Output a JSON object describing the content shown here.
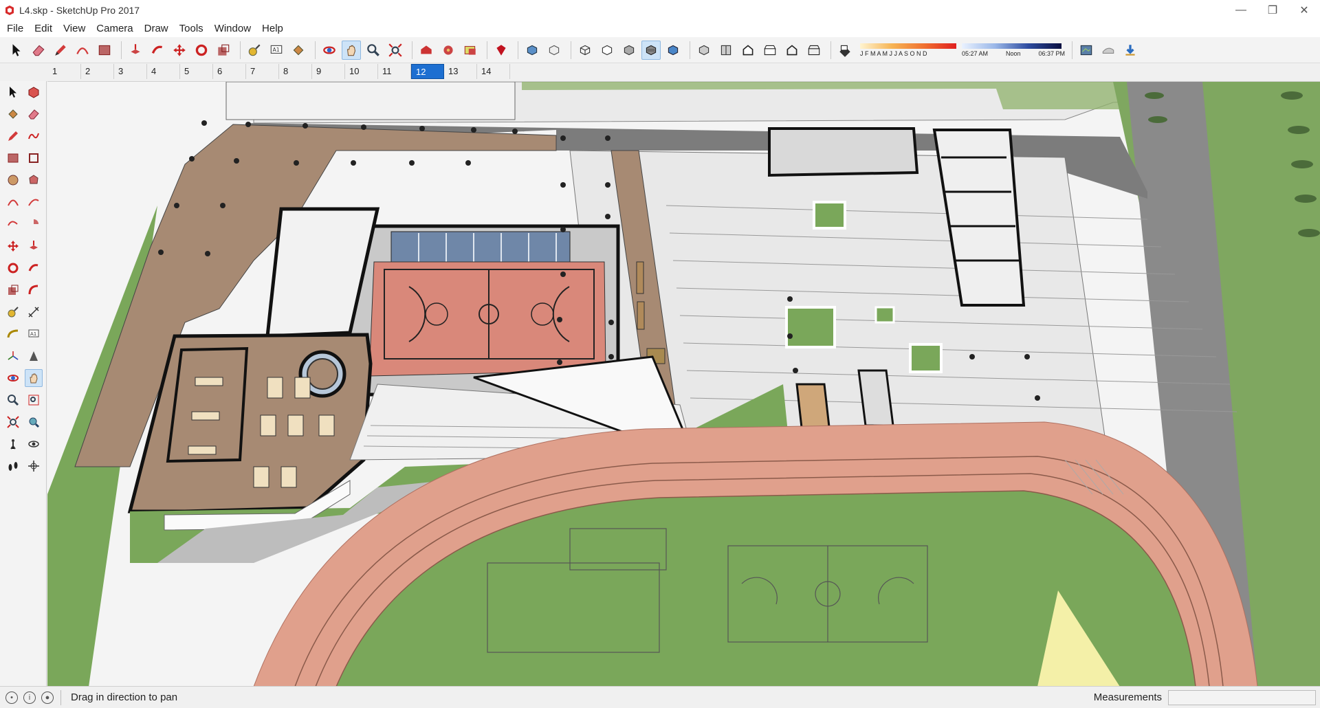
{
  "window": {
    "title": "L4.skp - SketchUp Pro 2017",
    "controls": {
      "minimize": "—",
      "restore": "❐",
      "close": "✕"
    }
  },
  "menu": [
    "File",
    "Edit",
    "View",
    "Camera",
    "Draw",
    "Tools",
    "Window",
    "Help"
  ],
  "toolbar": {
    "shadow_months": "J F M A M J J A S O N D",
    "shadow_times": {
      "start": "05:27 AM",
      "mid": "Noon",
      "end": "06:37 PM"
    },
    "groups": [
      [
        "select-icon",
        "eraser-icon",
        "pencil-icon",
        "arc-icon",
        "rectangle-icon"
      ],
      [
        "push-pull-icon",
        "follow-me-icon",
        "move-icon",
        "rotate-icon",
        "scale-icon"
      ],
      [
        "tape-measure-icon",
        "text-icon",
        "paint-bucket-icon"
      ],
      [
        "orbit-icon",
        "pan-icon",
        "zoom-icon",
        "zoom-extents-icon"
      ],
      [
        "warehouse-icon",
        "extension-warehouse-icon",
        "layout-icon"
      ],
      [
        "ruby-icon"
      ],
      [
        "xray-icon",
        "back-edges-icon"
      ],
      [
        "wireframe-icon",
        "hidden-line-icon",
        "shaded-icon",
        "shaded-textures-icon",
        "monochrome-icon"
      ],
      [
        "iso-view-icon",
        "top-view-icon",
        "front-view-icon",
        "right-view-icon",
        "back-view-icon",
        "left-view-icon"
      ],
      [
        "shadows-toggle-icon"
      ],
      [
        "location-icon",
        "sandbox-icon",
        "get-models-icon"
      ]
    ]
  },
  "scenes": [
    "1",
    "2",
    "3",
    "4",
    "5",
    "6",
    "7",
    "8",
    "9",
    "10",
    "11",
    "12",
    "13",
    "14"
  ],
  "active_scene": "12",
  "left_tools": [
    [
      "select-icon",
      "component-icon"
    ],
    [
      "paint-bucket-icon",
      "eraser-icon"
    ],
    [
      "pencil-icon",
      "freehand-icon"
    ],
    [
      "rectangle-icon",
      "rotated-rectangle-icon"
    ],
    [
      "circle-icon",
      "polygon-icon"
    ],
    [
      "arc-icon",
      "two-point-arc-icon"
    ],
    [
      "three-point-arc-icon",
      "pie-icon"
    ],
    [
      "move-icon",
      "push-pull-icon"
    ],
    [
      "rotate-icon",
      "follow-me-icon"
    ],
    [
      "scale-icon",
      "offset-icon"
    ],
    [
      "tape-measure-icon",
      "dimension-icon"
    ],
    [
      "protractor-icon",
      "text-icon"
    ],
    [
      "axes-icon",
      "3d-text-icon"
    ],
    [
      "orbit-icon",
      "pan-icon"
    ],
    [
      "zoom-icon",
      "zoom-window-icon"
    ],
    [
      "zoom-extents-icon",
      "previous-view-icon"
    ],
    [
      "position-camera-icon",
      "look-around-icon"
    ],
    [
      "walk-icon",
      "section-plane-icon"
    ]
  ],
  "status": {
    "message": "Drag in direction to pan",
    "measurements_label": "Measurements",
    "measurements_value": ""
  },
  "colors": {
    "grass": "#7aa75a",
    "court": "#d9887a",
    "track": "#e0a08c",
    "deck": "#a98a72",
    "road": "#7a7a7a",
    "accent_selected": "#1d6fd1"
  }
}
